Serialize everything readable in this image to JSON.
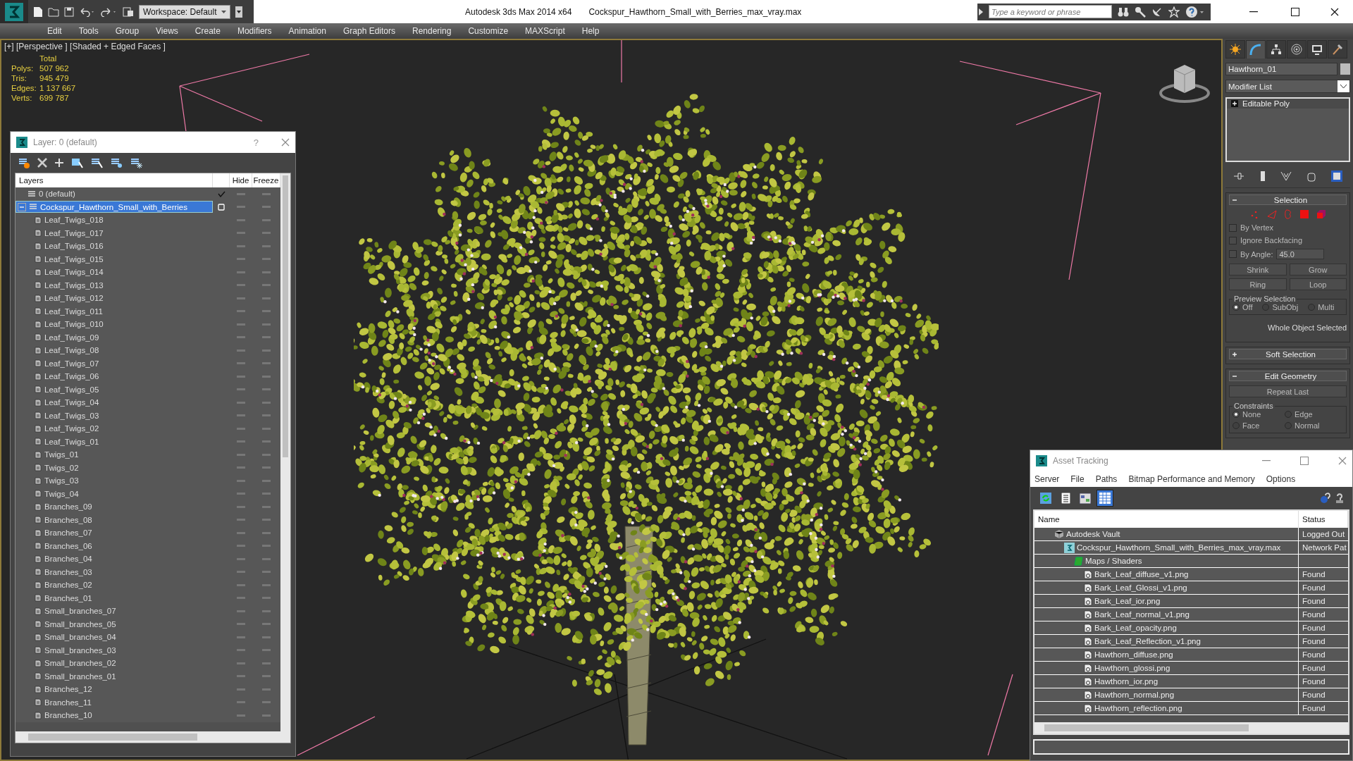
{
  "title_bar": {
    "workspace": "Workspace: Default",
    "app_title": "Autodesk 3ds Max  2014 x64",
    "file_name": "Cockspur_Hawthorn_Small_with_Berries_max_vray.max",
    "search": {
      "placeholder": "Type a keyword or phrase"
    }
  },
  "menu": [
    "Edit",
    "Tools",
    "Group",
    "Views",
    "Create",
    "Modifiers",
    "Animation",
    "Graph Editors",
    "Rendering",
    "Customize",
    "MAXScript",
    "Help"
  ],
  "viewport": {
    "label": "[+] [Perspective ] [Shaded + Edged Faces ]",
    "stats_header": "Total",
    "stats": [
      {
        "label": "Polys:",
        "value": "507 962"
      },
      {
        "label": "Tris:",
        "value": "945 479"
      },
      {
        "label": "Edges:",
        "value": "1 137 667"
      },
      {
        "label": "Verts:",
        "value": "699 787"
      }
    ]
  },
  "layer_dialog": {
    "title": "Layer: 0 (default)",
    "help": "?",
    "columns": [
      "Layers",
      "Hide",
      "Freeze"
    ],
    "layers": [
      {
        "name": "0 (default)",
        "selected": false,
        "current": true
      },
      {
        "name": "Cockspur_Hawthorn_Small_with_Berries",
        "selected": true,
        "current": false,
        "expanded": true,
        "children": [
          {
            "name": "Leaf_Twigs_018",
            "selected": false
          },
          {
            "name": "Leaf_Twigs_017",
            "selected": false
          },
          {
            "name": "Leaf_Twigs_016",
            "selected": false
          },
          {
            "name": "Leaf_Twigs_015",
            "selected": false
          },
          {
            "name": "Leaf_Twigs_014",
            "selected": false
          },
          {
            "name": "Leaf_Twigs_013",
            "selected": false
          },
          {
            "name": "Leaf_Twigs_012",
            "selected": false
          },
          {
            "name": "Leaf_Twigs_011",
            "selected": false
          },
          {
            "name": "Leaf_Twigs_010",
            "selected": false
          },
          {
            "name": "Leaf_Twigs_09",
            "selected": false
          },
          {
            "name": "Leaf_Twigs_08",
            "selected": false
          },
          {
            "name": "Leaf_Twigs_07",
            "selected": false
          },
          {
            "name": "Leaf_Twigs_06",
            "selected": false
          },
          {
            "name": "Leaf_Twigs_05",
            "selected": false
          },
          {
            "name": "Leaf_Twigs_04",
            "selected": false
          },
          {
            "name": "Leaf_Twigs_03",
            "selected": false
          },
          {
            "name": "Leaf_Twigs_02",
            "selected": false
          },
          {
            "name": "Leaf_Twigs_01",
            "selected": false
          },
          {
            "name": "Twigs_01",
            "selected": false
          },
          {
            "name": "Twigs_02",
            "selected": false
          },
          {
            "name": "Twigs_03",
            "selected": false
          },
          {
            "name": "Twigs_04",
            "selected": false
          },
          {
            "name": "Branches_09",
            "selected": false
          },
          {
            "name": "Branches_08",
            "selected": false
          },
          {
            "name": "Branches_07",
            "selected": false
          },
          {
            "name": "Branches_06",
            "selected": false
          },
          {
            "name": "Branches_04",
            "selected": false
          },
          {
            "name": "Branches_03",
            "selected": false
          },
          {
            "name": "Branches_02",
            "selected": false
          },
          {
            "name": "Branches_01",
            "selected": false
          },
          {
            "name": "Small_branches_07",
            "selected": false
          },
          {
            "name": "Small_branches_05",
            "selected": false
          },
          {
            "name": "Small_branches_04",
            "selected": false
          },
          {
            "name": "Small_branches_03",
            "selected": false
          },
          {
            "name": "Small_branches_02",
            "selected": false
          },
          {
            "name": "Small_branches_01",
            "selected": false
          },
          {
            "name": "Branches_12",
            "selected": false
          },
          {
            "name": "Branches_11",
            "selected": false
          },
          {
            "name": "Branches_10",
            "selected": false
          }
        ]
      }
    ]
  },
  "command_panel": {
    "tabs": [
      {
        "kind": "create",
        "selected": false
      },
      {
        "kind": "modify",
        "selected": true
      },
      {
        "kind": "hierarchy",
        "selected": false
      },
      {
        "kind": "motion",
        "selected": false
      },
      {
        "kind": "display",
        "selected": false
      },
      {
        "kind": "utilities",
        "selected": false
      }
    ],
    "object_name": "Hawthorn_01",
    "modifier_list": "Modifier List",
    "stack": [
      {
        "name": "Editable Poly",
        "expanded": false
      }
    ],
    "rollouts": [
      {
        "kind": "selection",
        "title": "Selection",
        "expanded": true,
        "checkboxes": [
          {
            "label": "By Vertex",
            "checked": false
          },
          {
            "label": "Ignore Backfacing",
            "checked": false
          },
          {
            "label": "By Angle:",
            "checked": false
          }
        ],
        "angle": "45.0",
        "buttons": [
          "Shrink",
          "Grow",
          "Ring",
          "Loop"
        ],
        "preview": {
          "title": "Preview Selection",
          "options": [
            {
              "label": "Off",
              "selected": true
            },
            {
              "label": "SubObj",
              "selected": false
            },
            {
              "label": "Multi",
              "selected": false
            }
          ]
        },
        "status": "Whole Object Selected"
      },
      {
        "kind": "soft",
        "title": "Soft Selection",
        "expanded": false
      },
      {
        "kind": "geometry",
        "title": "Edit Geometry",
        "expanded": true,
        "button": "Repeat Last",
        "constraints": {
          "title": "Constraints",
          "options": [
            {
              "label": "None",
              "selected": true
            },
            {
              "label": "Edge",
              "selected": false
            },
            {
              "label": "Face",
              "selected": false
            },
            {
              "label": "Normal",
              "selected": false
            }
          ]
        }
      }
    ]
  },
  "asset_tracking": {
    "title": "Asset Tracking",
    "menu": [
      "Server",
      "File",
      "Paths",
      "Bitmap Performance and Memory",
      "Options"
    ],
    "toolbar": [
      {
        "kind": "refresh",
        "selected": false
      },
      {
        "kind": "list",
        "selected": false
      },
      {
        "kind": "thumbs",
        "selected": false
      },
      {
        "kind": "table",
        "selected": true
      }
    ],
    "columns": [
      "Name",
      "Status"
    ],
    "rows": [
      {
        "kind": "vault",
        "name": "Autodesk Vault",
        "status": "Logged Out",
        "children": [
          {
            "kind": "scene",
            "name": "Cockspur_Hawthorn_Small_with_Berries_max_vray.max",
            "status": "Network Pat",
            "children": [
              {
                "kind": "folder",
                "name": "Maps / Shaders",
                "children": [
                  {
                    "kind": "bitmap",
                    "name": "Bark_Leaf_diffuse_v1.png",
                    "status": "Found"
                  },
                  {
                    "kind": "bitmap",
                    "name": "Bark_Leaf_Glossi_v1.png",
                    "status": "Found"
                  },
                  {
                    "kind": "bitmap",
                    "name": "Bark_Leaf_ior.png",
                    "status": "Found"
                  },
                  {
                    "kind": "bitmap",
                    "name": "Bark_Leaf_normal_v1.png",
                    "status": "Found"
                  },
                  {
                    "kind": "bitmap",
                    "name": "Bark_Leaf_opacity.png",
                    "status": "Found"
                  },
                  {
                    "kind": "bitmap",
                    "name": "Bark_Leaf_Reflection_v1.png",
                    "status": "Found"
                  },
                  {
                    "kind": "bitmap",
                    "name": "Hawthorn_diffuse.png",
                    "status": "Found"
                  },
                  {
                    "kind": "bitmap",
                    "name": "Hawthorn_glossi.png",
                    "status": "Found"
                  },
                  {
                    "kind": "bitmap",
                    "name": "Hawthorn_ior.png",
                    "status": "Found"
                  },
                  {
                    "kind": "bitmap",
                    "name": "Hawthorn_normal.png",
                    "status": "Found"
                  },
                  {
                    "kind": "bitmap",
                    "name": "Hawthorn_reflection.png",
                    "status": "Found"
                  }
                ]
              }
            ]
          }
        ]
      }
    ]
  }
}
